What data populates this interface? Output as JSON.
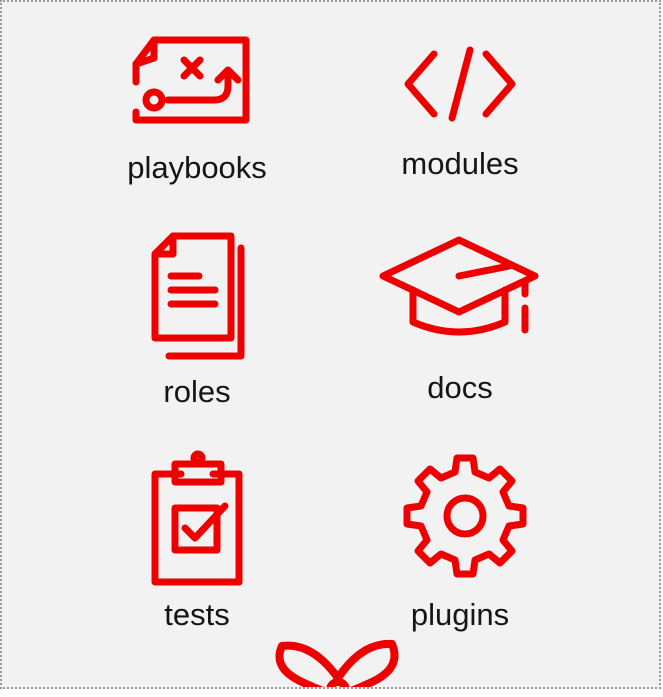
{
  "accent_color": "#ee0000",
  "items": [
    {
      "label": "playbooks",
      "icon": "map-play-icon"
    },
    {
      "label": "modules",
      "icon": "code-icon"
    },
    {
      "label": "roles",
      "icon": "document-stack-icon"
    },
    {
      "label": "docs",
      "icon": "graduation-cap-icon"
    },
    {
      "label": "tests",
      "icon": "clipboard-check-icon"
    },
    {
      "label": "plugins",
      "icon": "gear-icon"
    }
  ],
  "bottom_icon": "atom-icon"
}
